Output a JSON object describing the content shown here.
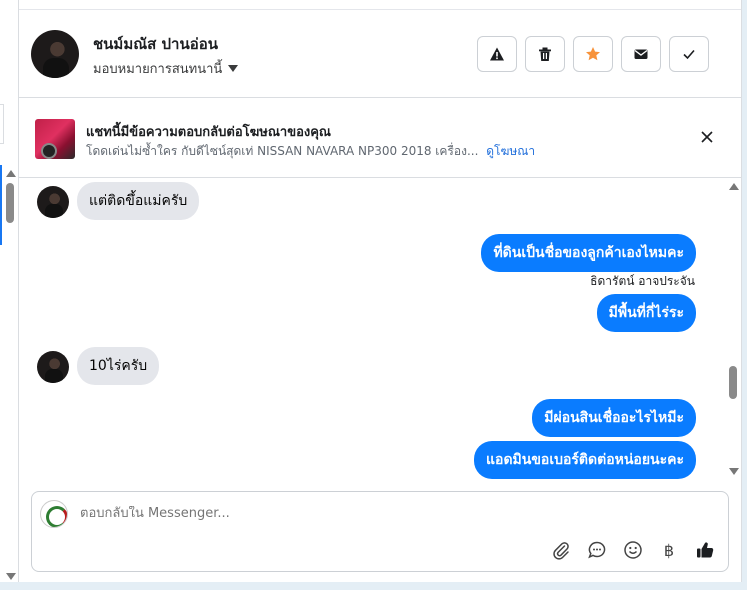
{
  "header": {
    "contact_name": "ชนม์มณัส ปานอ่อน",
    "assign_label": "มอบหมายการสนทนานี้",
    "actions": [
      {
        "name": "report-button",
        "icon": "warning-icon"
      },
      {
        "name": "delete-button",
        "icon": "trash-icon"
      },
      {
        "name": "star-button",
        "icon": "star-icon",
        "color": "#f7923a"
      },
      {
        "name": "mail-button",
        "icon": "envelope-icon"
      },
      {
        "name": "done-button",
        "icon": "check-icon"
      }
    ]
  },
  "ad_banner": {
    "title": "แชทนี้มีข้อความตอบกลับต่อโฆษณาของคุณ",
    "description": "โดดเด่นไม่ซ้ำใคร กับดีไซน์สุดเท่ NISSAN NAVARA NP300 2018 เครื่อง...",
    "link": "ดูโฆษณา"
  },
  "messages": {
    "m1": {
      "text": "แต่ติดขึ้อแม่ครับ"
    },
    "m2": {
      "text": "ที่ดินเป็นชื่อของลูกค้าเองไหมคะ"
    },
    "sender_name": "ธิดารัตน์ อาจประจัน",
    "m3": {
      "text": "มีพื้นที่กี่ไร่ระ"
    },
    "m4": {
      "text": "10ไร่ครับ"
    },
    "m5": {
      "text": "มีผ่อนสินเชื่ออะไรไหมีะ"
    },
    "m6": {
      "text": "แอดมินขอเบอร์ติดต่อหน่อยนะคะ"
    }
  },
  "composer": {
    "placeholder": "ตอบกลับใน Messenger...",
    "tools": [
      "paperclip-icon",
      "chat-bubble-icon",
      "smiley-icon",
      "baht-icon",
      "thumbs-up-icon"
    ],
    "baht_symbol": "฿"
  },
  "colors": {
    "outgoing_bubble": "#0a7cff",
    "incoming_bubble": "#e4e6eb",
    "link": "#216fdb",
    "star": "#f7923a"
  }
}
